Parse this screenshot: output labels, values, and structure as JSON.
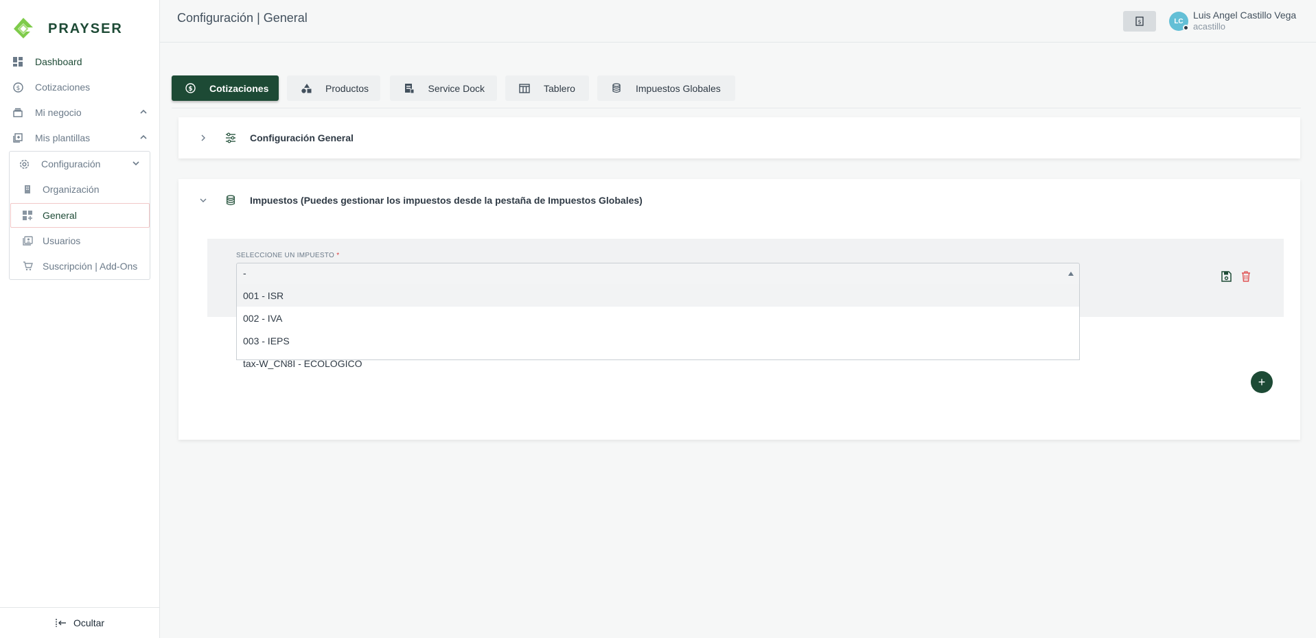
{
  "brand": {
    "name": "PRAYSER"
  },
  "sidebar": {
    "items": [
      {
        "label": "Dashboard",
        "icon": "dashboard-icon"
      },
      {
        "label": "Cotizaciones",
        "icon": "dollar-circle-icon"
      },
      {
        "label": "Mi negocio",
        "icon": "business-icon"
      },
      {
        "label": "Mis plantillas",
        "icon": "templates-icon"
      },
      {
        "label": "Configuración",
        "icon": "gear-icon"
      }
    ],
    "sub_items": [
      {
        "label": "Organización",
        "icon": "building-icon"
      },
      {
        "label": "General",
        "icon": "grid-plus-icon"
      },
      {
        "label": "Usuarios",
        "icon": "users-icon"
      },
      {
        "label": "Suscripción | Add-Ons",
        "icon": "cart-icon"
      }
    ],
    "hide_label": "Ocultar"
  },
  "header": {
    "title": "Configuración | General",
    "user_name": "Luis Angel Castillo Vega",
    "user_handle": "acastillo",
    "avatar_initials": "LC"
  },
  "tabs": [
    {
      "label": "Cotizaciones",
      "icon": "dollar-circle-icon"
    },
    {
      "label": "Productos",
      "icon": "shapes-icon"
    },
    {
      "label": "Service Dock",
      "icon": "document-icon"
    },
    {
      "label": "Tablero",
      "icon": "columns-icon"
    },
    {
      "label": "Impuestos Globales",
      "icon": "database-icon"
    }
  ],
  "panels": {
    "general": {
      "title": "Configuración General",
      "icon": "sliders-icon"
    },
    "taxes": {
      "title": "Impuestos (Puedes gestionar los impuestos desde la pestaña de Impuestos Globales)",
      "icon": "database-icon"
    }
  },
  "tax_select": {
    "label": "SELECCIONE UN IMPUESTO",
    "required_mark": "*",
    "value": "-",
    "options": [
      "001 - ISR",
      "002 - IVA",
      "003 - IEPS",
      "tax-W_CN8I - ECOLOGICO"
    ]
  },
  "add_button": {
    "label": "+"
  },
  "colors": {
    "brand": "#1d4a35",
    "danger": "#e05252",
    "logo_green": "#7ecb4a"
  }
}
